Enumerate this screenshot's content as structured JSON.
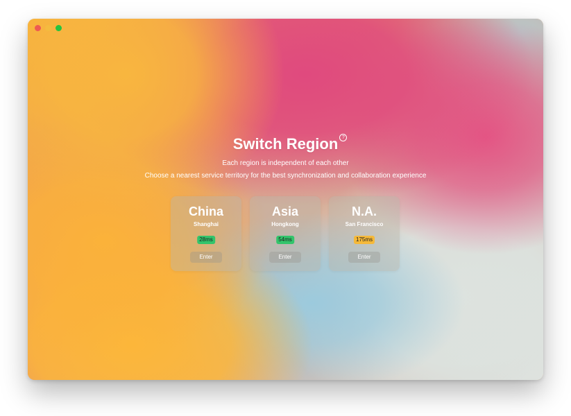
{
  "window": {
    "controls": [
      "close",
      "minimize",
      "zoom"
    ]
  },
  "header": {
    "title": "Switch Region",
    "help_icon": "question-circle-icon",
    "subtitle_1": "Each region is independent of each other",
    "subtitle_2": "Choose a nearest service territory for the best synchronization and collaboration experience"
  },
  "regions": [
    {
      "name": "China",
      "city": "Shanghai",
      "latency": "28ms",
      "latency_color": "#33c46b",
      "enter_label": "Enter"
    },
    {
      "name": "Asia",
      "city": "Hongkong",
      "latency": "54ms",
      "latency_color": "#33c46b",
      "enter_label": "Enter"
    },
    {
      "name": "N.A.",
      "city": "San Francisco",
      "latency": "175ms",
      "latency_color": "#f5b93a",
      "enter_label": "Enter"
    }
  ]
}
